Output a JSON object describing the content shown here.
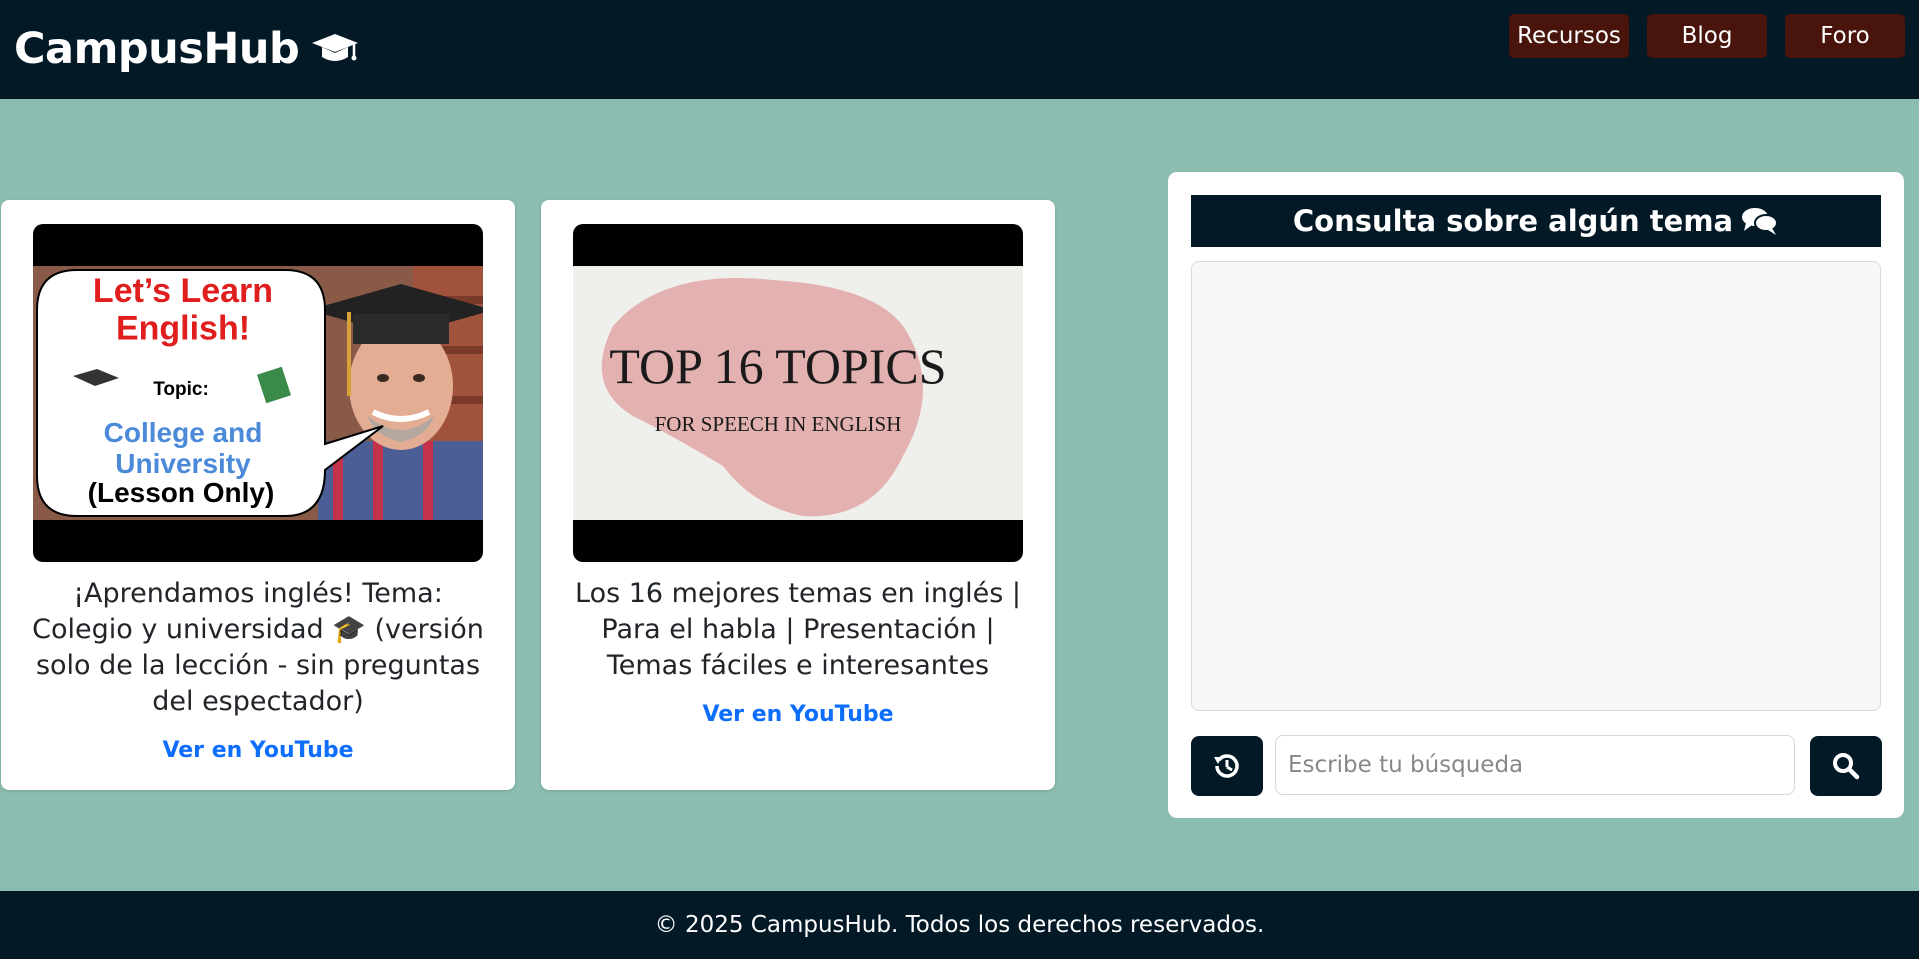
{
  "navbar": {
    "brand": "CampusHub",
    "brand_icon": "graduation-cap-icon",
    "links": [
      {
        "label": "Recursos"
      },
      {
        "label": "Blog"
      },
      {
        "label": "Foro"
      }
    ],
    "accent": "#48140c"
  },
  "videos": [
    {
      "thumb_lines": {
        "heading": "Let’s Learn English!",
        "topic": "Topic:",
        "subject": "College and University",
        "note": "(Lesson Only)"
      },
      "title": "¡Aprendamos inglés! Tema: Colegio y universidad 🎓 (versión solo de la lección - sin preguntas del espectador)",
      "link": "Ver en YouTube"
    },
    {
      "thumb_lines": {
        "heading": "TOP 16 TOPICS",
        "subheading": "FOR SPEECH IN ENGLISH"
      },
      "title": "Los 16 mejores temas en inglés | Para el habla | Presentación | Temas fáciles e interesantes",
      "link": "Ver en YouTube"
    }
  ],
  "chat": {
    "title": "Consulta sobre algún tema",
    "title_icon": "comments-icon",
    "history_icon": "history-icon",
    "search_placeholder": "Escribe tu búsqueda",
    "search_value": "",
    "search_icon": "search-icon"
  },
  "footer": {
    "text": "© 2025 CampusHub. Todos los derechos reservados."
  },
  "colors": {
    "navy": "#031926",
    "background": "#8bbdb0",
    "link": "#0d6efd"
  }
}
